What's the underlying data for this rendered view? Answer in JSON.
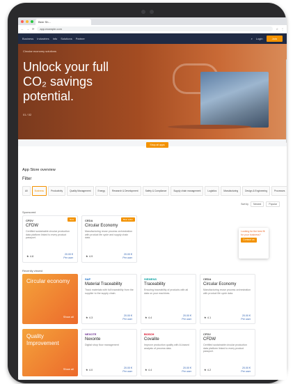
{
  "browser": {
    "tab_title": "Beer Sh...",
    "url": "app.example.com"
  },
  "nav": {
    "items": [
      "Business",
      "Industries",
      "Info",
      "Solutions",
      "Partner"
    ],
    "account": "Login",
    "join": "Join"
  },
  "hero": {
    "crumb": "Circular economy solutions",
    "title_line1": "Unlock your full",
    "title_line2": "CO₂ savings",
    "title_line3": "potential.",
    "meta": "01 / 02",
    "search_button": "Shop all apps"
  },
  "appstore": {
    "title": "App Store overview",
    "filters_title": "Filter",
    "filters": [
      "All",
      "Business",
      "Productivity",
      "Quality Management",
      "Energy",
      "Research & Development",
      "Safety & Compliance",
      "Supply chain management",
      "Logistics",
      "Manufacturing",
      "Design & Engineering",
      "Processes"
    ],
    "sort_label": "Sort by",
    "sort_options": [
      "Newest",
      "Popular"
    ]
  },
  "sponsored": {
    "label": "Sponsored",
    "cards": [
      {
        "vendor": "CFDV",
        "name": "CFDW",
        "desc": "Certified sustainable circular production data platform linked to every product passport.",
        "rating": "★ 4.8",
        "price": "20.00 €",
        "price_note": "Per user",
        "badge": "New"
      },
      {
        "vendor": "CEDA",
        "name": "Circular Economy",
        "desc": "Manufacturing reuse process orchestration with product life cycle and supply chain data.",
        "rating": "★ 4.9",
        "price": "20.00 €",
        "price_note": "Per user",
        "badge": "Best seller"
      }
    ]
  },
  "recently": {
    "label": "Recently viewed",
    "promos": [
      {
        "title": "Circular economy",
        "more": "Show all"
      },
      {
        "title": "Quality Improvement",
        "more": "Show all"
      }
    ],
    "cards": [
      {
        "vendor": "SAP",
        "name": "Material Traceability",
        "desc": "Track materials with full traceability from the supplier to the supply chain.",
        "rating": "★ 4.3",
        "price": "20.00 €",
        "price_note": "Per user"
      },
      {
        "vendor": "SIEMENS",
        "name": "Traceability",
        "desc": "Ensuring traceability of products with all data on your machines.",
        "rating": "★ 4.4",
        "price": "20.00 €",
        "price_note": "Per user"
      },
      {
        "vendor": "CEDA",
        "name": "Circular Economy",
        "desc": "Manufacturing reuse process orchestration with product life cycle data.",
        "rating": "★ 4.1",
        "price": "20.00 €",
        "price_note": "Per user"
      },
      {
        "vendor": "NEXOTE",
        "name": "Nexonte",
        "desc": "Digital shop floor management",
        "rating": "★ 4.0",
        "price": "20.00 €",
        "price_note": "Per user"
      },
      {
        "vendor": "BOSCH",
        "name": "Covalite",
        "desc": "Improve production quality with AI-based analysis of process data.",
        "rating": "★ 4.4",
        "price": "20.00 €",
        "price_note": "Per user"
      },
      {
        "vendor": "CFDV",
        "name": "CFDW",
        "desc": "Certified sustainable circular production data platform linked to every product passport.",
        "rating": "★ 4.2",
        "price": "20.00 €",
        "price_note": "Per user"
      }
    ]
  },
  "callout": {
    "text": "Looking for the best fit for your business?",
    "button": "Contact us"
  }
}
